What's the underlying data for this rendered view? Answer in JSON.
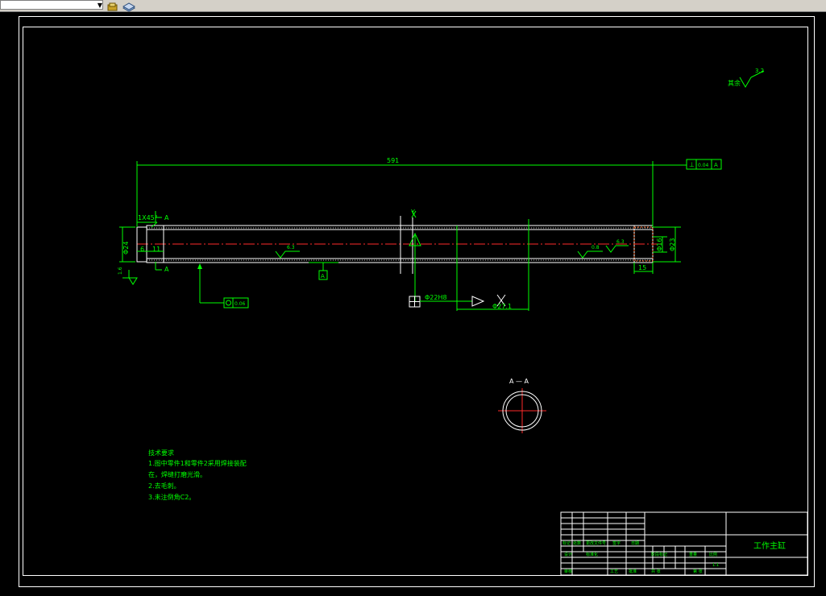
{
  "toolbar": {
    "layer_combo_value": "",
    "icons": [
      "layer-states-icon",
      "layer-manager-icon"
    ]
  },
  "drawing": {
    "length_dim": "591",
    "chamfer_note": "1X45°",
    "section_mark": "A",
    "section_mark_bottom": "A",
    "dia_left": "Φ24",
    "dim_6": "6",
    "dim_11": "11",
    "rough_left": "1.6",
    "rough_mid": "6.3",
    "rough_right1": "0.8",
    "rough_right2": "6.3",
    "rough_right3": "1.6",
    "dia_bore_right": "Φ16",
    "dia_outer_right": "Φ23",
    "dim_15": "15",
    "perp_tol_value": "0.04",
    "perp_tol_datum": "A",
    "datum_mid": "A",
    "circ_tol_value": "0.06",
    "bore_fit": "Φ22H8",
    "dia_outer_mid": "Φ27.1",
    "cyl_Y": "Y",
    "cyl_X": "X",
    "other_rough_label": "其余",
    "other_rough_value": "3.2",
    "section_title": "A — A"
  },
  "notes": {
    "title": "技术要求",
    "lines": [
      "1.图中零件1和零件2采用焊接装配",
      "  在，焊缝打磨光滑。",
      "2.去毛刺。",
      "3.未注倒角C2。"
    ]
  },
  "title_block": {
    "part_name": "工作主缸",
    "labels": [
      "标记",
      "处数",
      "更改文件号",
      "签字",
      "日期",
      "设计",
      "标准化",
      "审核",
      "工艺",
      "批准",
      "阶段标记",
      "重量",
      "比例",
      "共 张",
      "第 张"
    ],
    "scale": "1:1"
  }
}
